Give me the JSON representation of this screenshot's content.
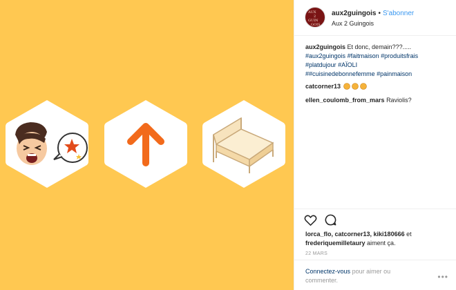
{
  "post_image": {
    "background": "#ffc851",
    "icons": [
      "shouting-face-icon",
      "up-arrow-icon",
      "bed-icon"
    ]
  },
  "header": {
    "username": "aux2guingois",
    "separator": "•",
    "follow_label": "S'abonner",
    "subtitle": "Aux 2 Guingois",
    "avatar_text": [
      "AUX",
      "2",
      "GUIN",
      "GOIS"
    ]
  },
  "caption": {
    "username": "aux2guingois",
    "text": "Et donc, demain???.....",
    "hashtags": [
      "#aux2guingois",
      "#faitmaison",
      "#produitsfrais",
      "#platdujour",
      "#AÏOLI",
      "##cuisinedebonnefemme",
      "#painmaison"
    ]
  },
  "comments": [
    {
      "username": "catcorner13",
      "text": ""
    },
    {
      "username": "ellen_coulomb_from_mars",
      "text": "Raviolis?"
    }
  ],
  "likes": {
    "users_line1": "lorca_flo, catcorner13, kiki180666",
    "connector": "et",
    "users_line2": "frederiquemilletaury",
    "suffix": "aiment ça."
  },
  "date": "22 MARS",
  "login": {
    "link_label": "Connectez-vous",
    "text": "pour aimer ou commenter.",
    "more_label": "•••"
  },
  "colors": {
    "accent": "#3897f0",
    "link": "#003569",
    "arrow": "#f26a1b",
    "bed": "#f4d9a8"
  }
}
